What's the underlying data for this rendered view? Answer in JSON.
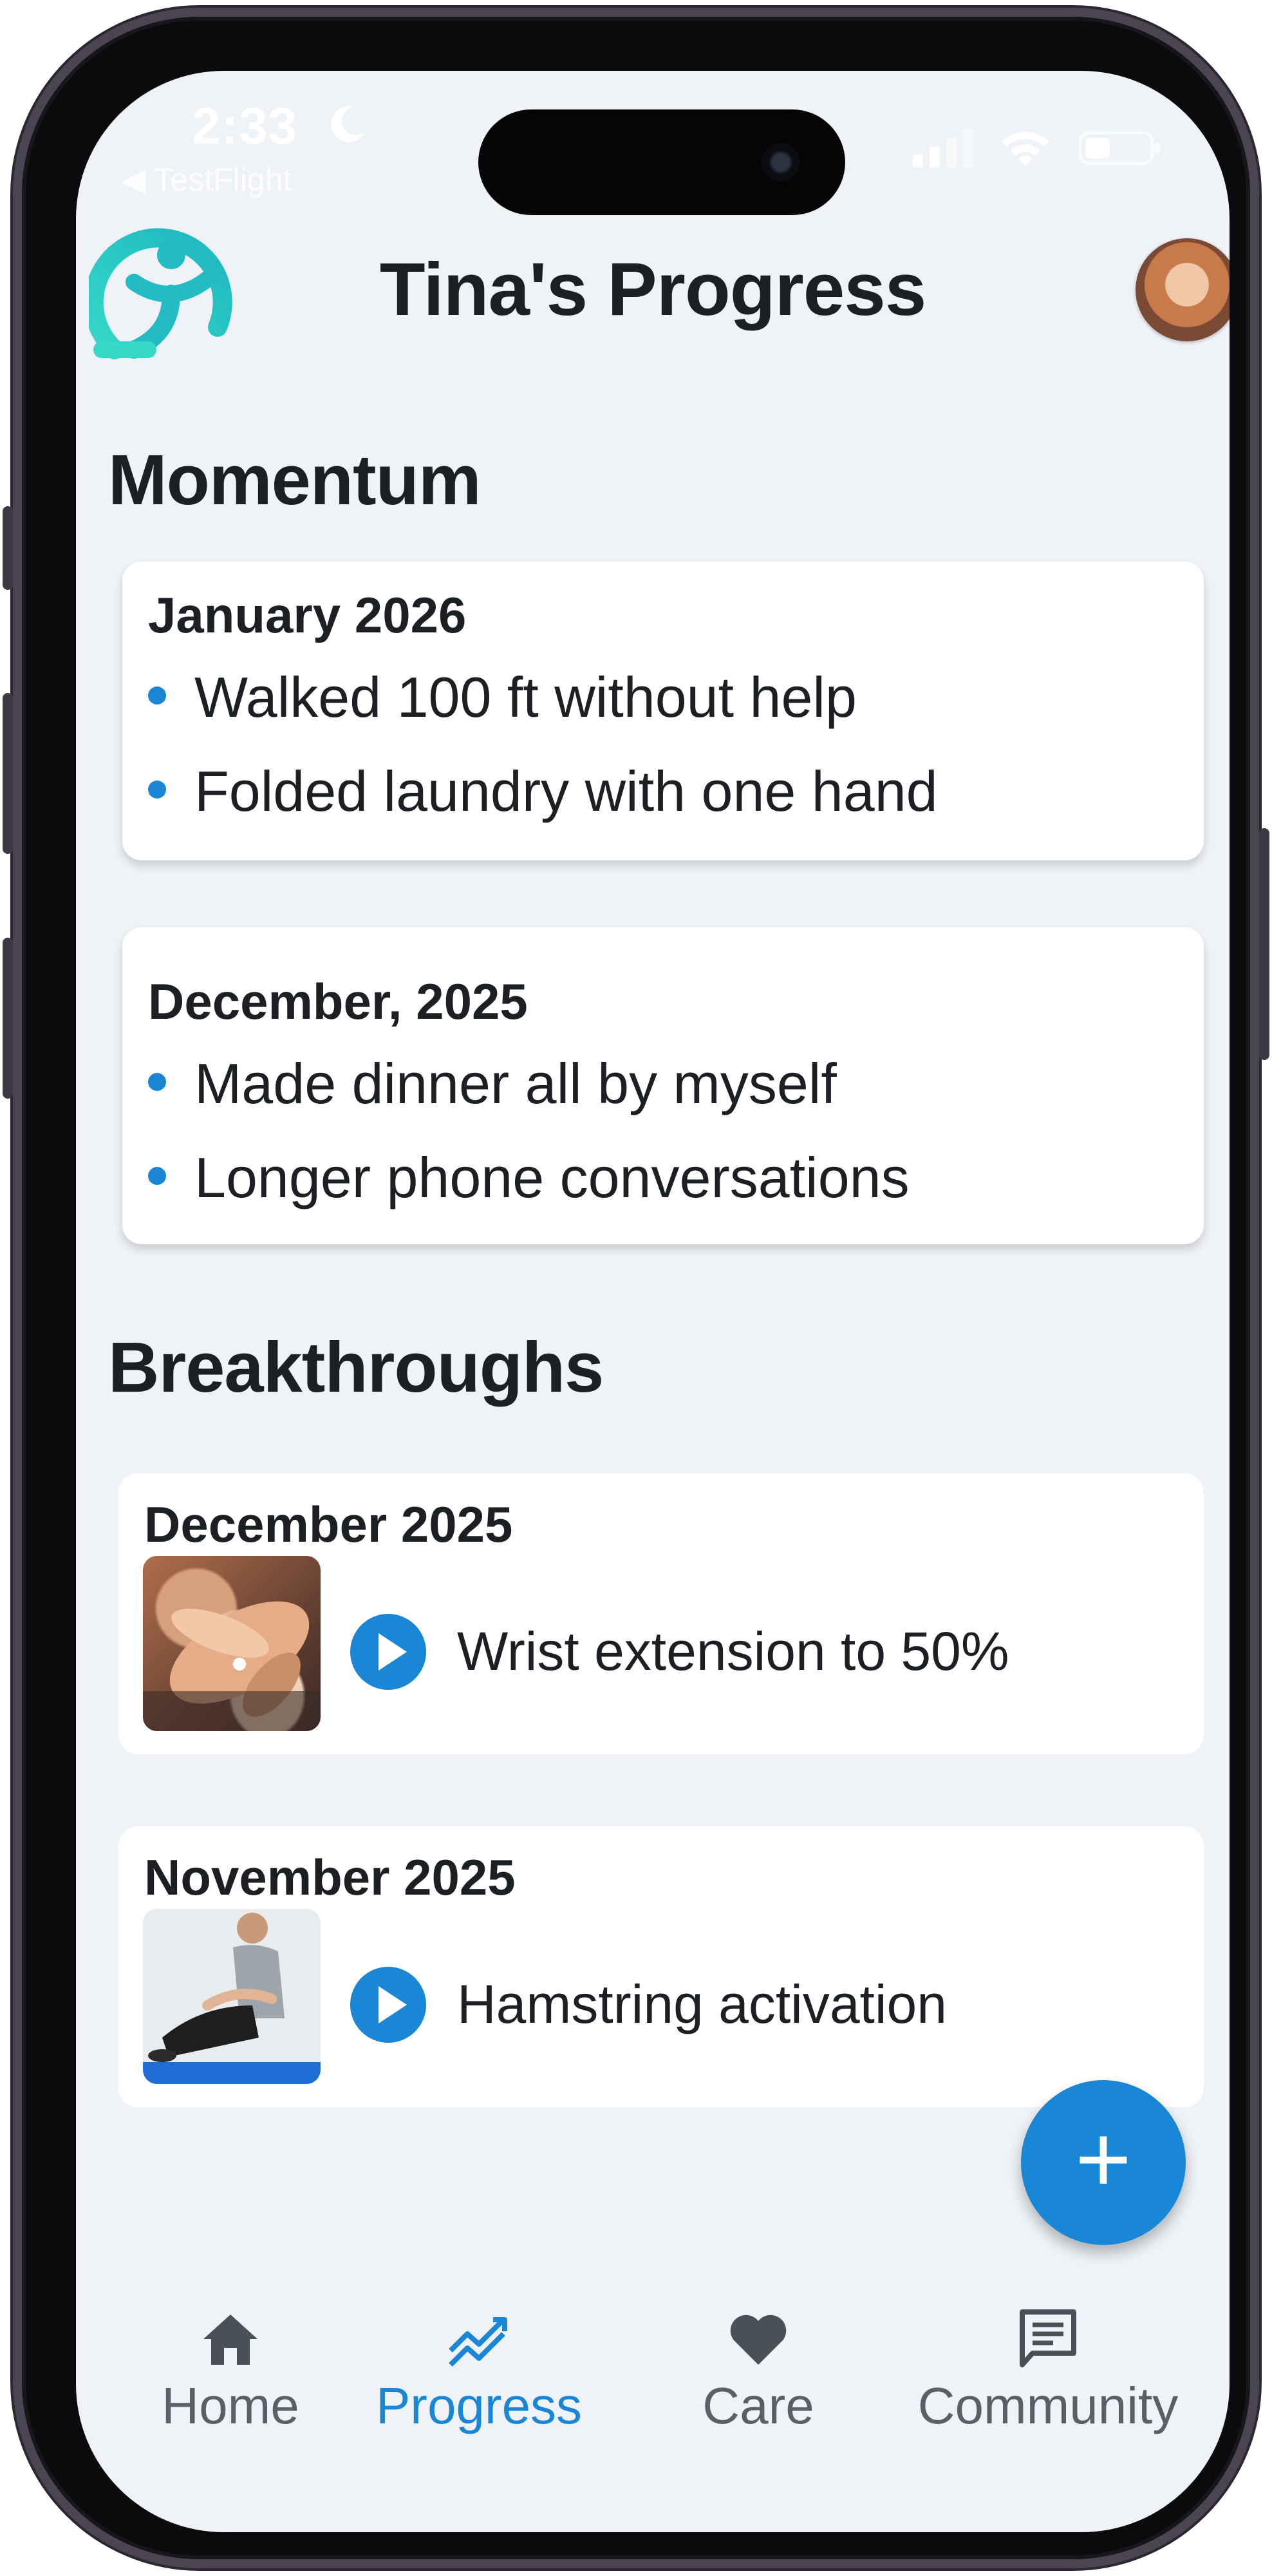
{
  "status_bar": {
    "time": "2:33",
    "back_app": "◀ TestFlight"
  },
  "header": {
    "title": "Tina's Progress"
  },
  "momentum": {
    "title": "Momentum",
    "cards": [
      {
        "heading": "January 2026",
        "items": [
          "Walked 100 ft without help",
          "Folded laundry with one hand"
        ]
      },
      {
        "heading": "December, 2025",
        "items": [
          "Made dinner all by myself",
          "Longer phone conversations"
        ]
      }
    ]
  },
  "breakthroughs": {
    "title": "Breakthroughs",
    "items": [
      {
        "heading": "December 2025",
        "label": "Wrist extension to 50%",
        "thumb_icon": "hands-photo"
      },
      {
        "heading": "November 2025",
        "label": "Hamstring activation",
        "thumb_icon": "therapy-photo"
      }
    ]
  },
  "fab": {
    "icon": "plus-icon",
    "label": "+"
  },
  "tab_bar": {
    "tabs": [
      {
        "label": "Home",
        "icon": "home-icon",
        "active": false
      },
      {
        "label": "Progress",
        "icon": "trending-icon",
        "active": true
      },
      {
        "label": "Care",
        "icon": "heart-icon",
        "active": false
      },
      {
        "label": "Community",
        "icon": "chat-icon",
        "active": false
      }
    ]
  },
  "colors": {
    "accent": "#1a86d6",
    "background": "#eff2f7",
    "logo": "#2bc8c0",
    "text": "#1c1f24"
  }
}
